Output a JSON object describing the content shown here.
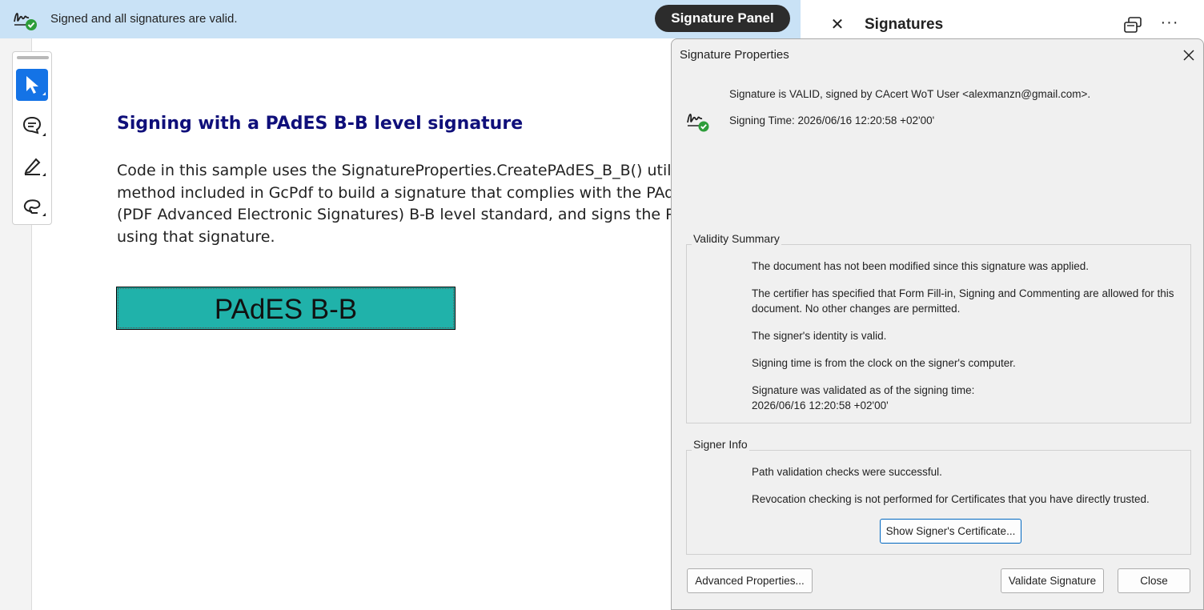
{
  "banner": {
    "icon": "signature-valid-icon",
    "message": "Signed and all signatures are valid.",
    "panel_button": "Signature Panel"
  },
  "signatures_panel": {
    "title": "Signatures",
    "icons": [
      "close-icon",
      "cascade-windows-icon",
      "more-options-icon"
    ]
  },
  "toolbar": {
    "tools": [
      "select-icon",
      "add-comment-icon",
      "draw-icon",
      "lasso-icon"
    ],
    "accent_color": "#1473e6"
  },
  "document": {
    "heading": "Signing with a PAdES B-B level signature",
    "body_lines": [
      "Code in this sample uses the SignatureProperties.CreatePAdES_B_B() utility",
      "method included in GcPdf to build a signature that complies with the PAdES",
      "(PDF Advanced Electronic Signatures) B-B level standard, and signs the PDF",
      "using that signature."
    ],
    "signature_field_label": "PAdES B-B",
    "signature_field_color": "#20b2aa",
    "heading_color": "#0f0f7a"
  },
  "dialog": {
    "title": "Signature Properties",
    "status": "Signature is VALID, signed by CAcert WoT User <alexmanzn@gmail.com>.",
    "signing_time": "Signing Time:  2026/06/16 12:20:58 +02'00'",
    "validity_summary": {
      "label": "Validity Summary",
      "lines": [
        "The document has not been modified since this signature was applied.",
        "The certifier has specified that Form Fill-in, Signing and Commenting are allowed for this document. No other changes are permitted.",
        "The signer's identity is valid.",
        "Signing time is from the clock on the signer's computer.",
        "Signature was validated as of the signing time:",
        "2026/06/16 12:20:58 +02'00'"
      ]
    },
    "signer_info": {
      "label": "Signer Info",
      "lines": [
        "Path validation checks were successful.",
        "Revocation checking is not performed for Certificates that you have directly trusted."
      ],
      "show_certificate_button": "Show Signer's Certificate..."
    },
    "buttons": {
      "advanced": "Advanced Properties...",
      "validate": "Validate Signature",
      "close": "Close"
    }
  }
}
